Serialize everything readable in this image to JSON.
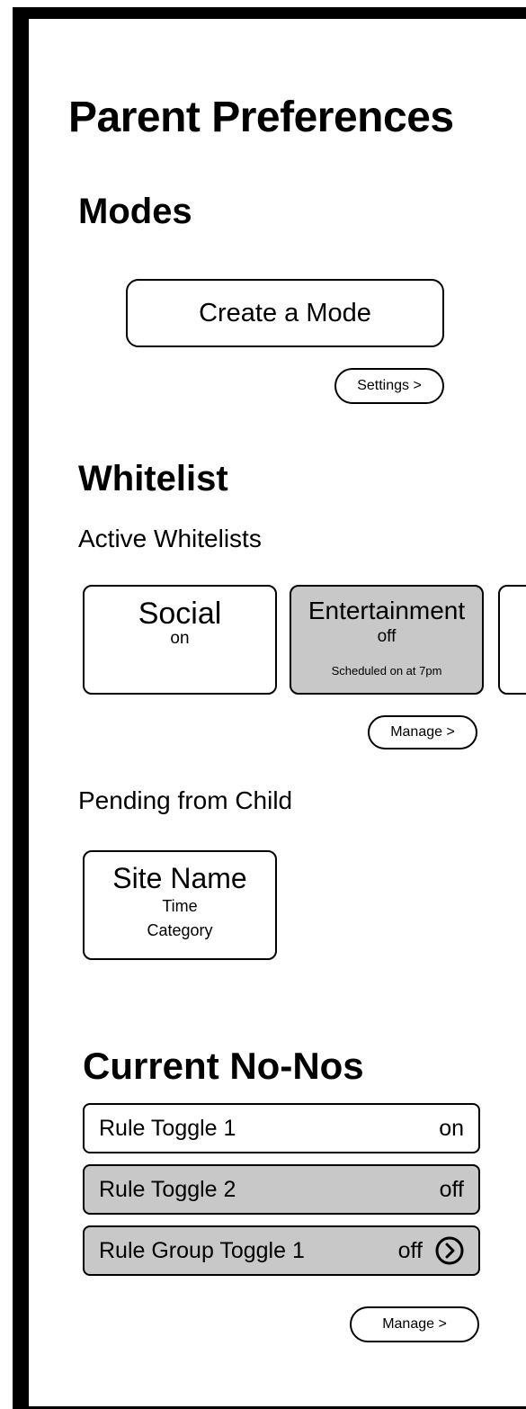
{
  "page": {
    "title": "Parent Preferences"
  },
  "modes": {
    "heading": "Modes",
    "create_label": "Create a Mode",
    "settings_label": "Settings >"
  },
  "whitelist": {
    "heading": "Whitelist",
    "active_label": "Active Whitelists",
    "cards": [
      {
        "name": "Social",
        "state": "on",
        "schedule": ""
      },
      {
        "name": "Entertainment",
        "state": "off",
        "schedule": "Scheduled on at 7pm"
      }
    ],
    "manage_label": "Manage >",
    "pending_label": "Pending from Child",
    "pending_card": {
      "site": "Site Name",
      "time": "Time",
      "category": "Category"
    }
  },
  "nonos": {
    "heading": "Current No-Nos",
    "rules": [
      {
        "label": "Rule Toggle 1",
        "state": "on"
      },
      {
        "label": "Rule Toggle 2",
        "state": "off"
      },
      {
        "label": "Rule Group Toggle 1",
        "state": "off",
        "icon": "chevron-right-circle-icon"
      }
    ],
    "manage_label": "Manage >"
  }
}
